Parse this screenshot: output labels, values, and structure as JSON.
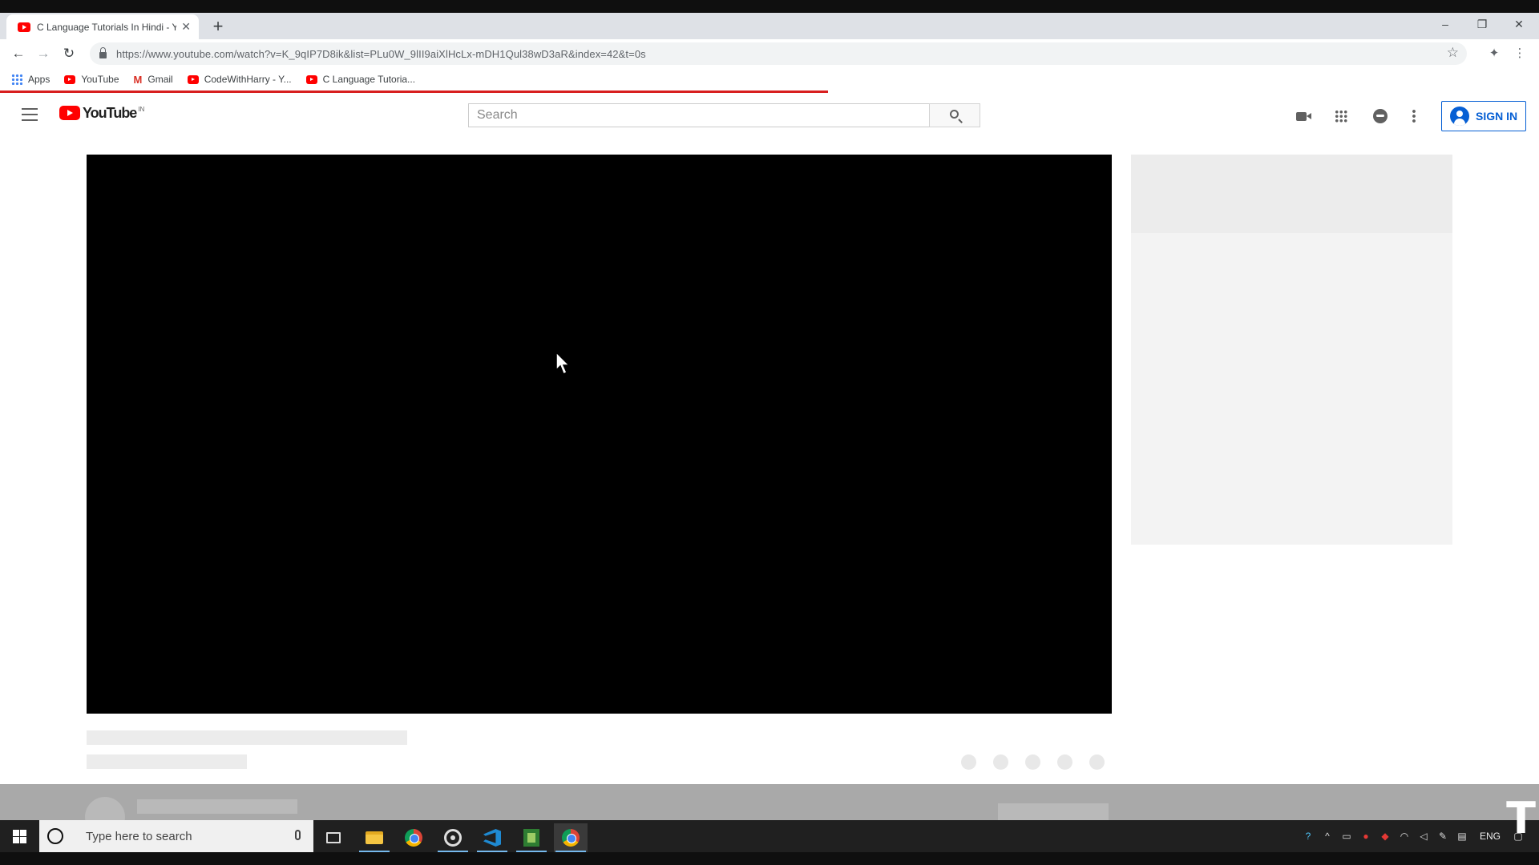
{
  "browser": {
    "tab_title": "C Language Tutorials In Hindi - Y",
    "url": "https://www.youtube.com/watch?v=K_9qIP7D8ik&list=PLu0W_9lII9aiXlHcLx-mDH1Qul38wD3aR&index=42&t=0s",
    "window_controls": {
      "minimize": "–",
      "restore": "❐",
      "close": "✕"
    }
  },
  "bookmarks": [
    {
      "label": "Apps",
      "icon": "apps-grid-icon"
    },
    {
      "label": "YouTube",
      "icon": "youtube-icon"
    },
    {
      "label": "Gmail",
      "icon": "gmail-icon"
    },
    {
      "label": "CodeWithHarry - Y...",
      "icon": "youtube-icon"
    },
    {
      "label": "C Language Tutoria...",
      "icon": "youtube-icon"
    }
  ],
  "youtube": {
    "logo_text": "YouTube",
    "region": "IN",
    "search_placeholder": "Search",
    "sign_in_label": "SIGN IN"
  },
  "taskbar": {
    "search_placeholder": "Type here to search",
    "language": "ENG",
    "apps": [
      "task-view",
      "file-explorer",
      "chrome",
      "camera",
      "vs-code",
      "spreadsheet",
      "chrome-profile"
    ]
  },
  "overlay_glyph": "T",
  "colors": {
    "youtube_red": "#ff0000",
    "sign_in_blue": "#065fd4",
    "loading_bar": "#d81f1f"
  }
}
